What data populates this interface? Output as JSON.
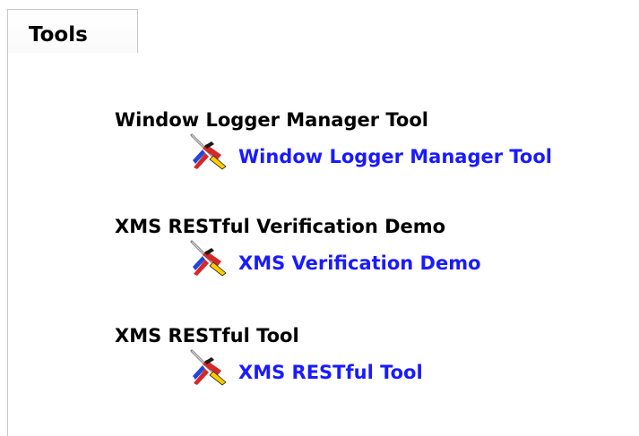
{
  "tab": {
    "label": "Tools"
  },
  "tools": [
    {
      "title": "Window Logger Manager Tool",
      "link_label": "Window Logger Manager Tool",
      "icon": "tools-icon"
    },
    {
      "title": "XMS RESTful Verification Demo",
      "link_label": "XMS Verification Demo",
      "icon": "tools-icon"
    },
    {
      "title": "XMS RESTful Tool",
      "link_label": "XMS RESTful Tool",
      "icon": "tools-icon"
    }
  ],
  "colors": {
    "link": "#1a1aff",
    "border": "#c9c9c9"
  }
}
